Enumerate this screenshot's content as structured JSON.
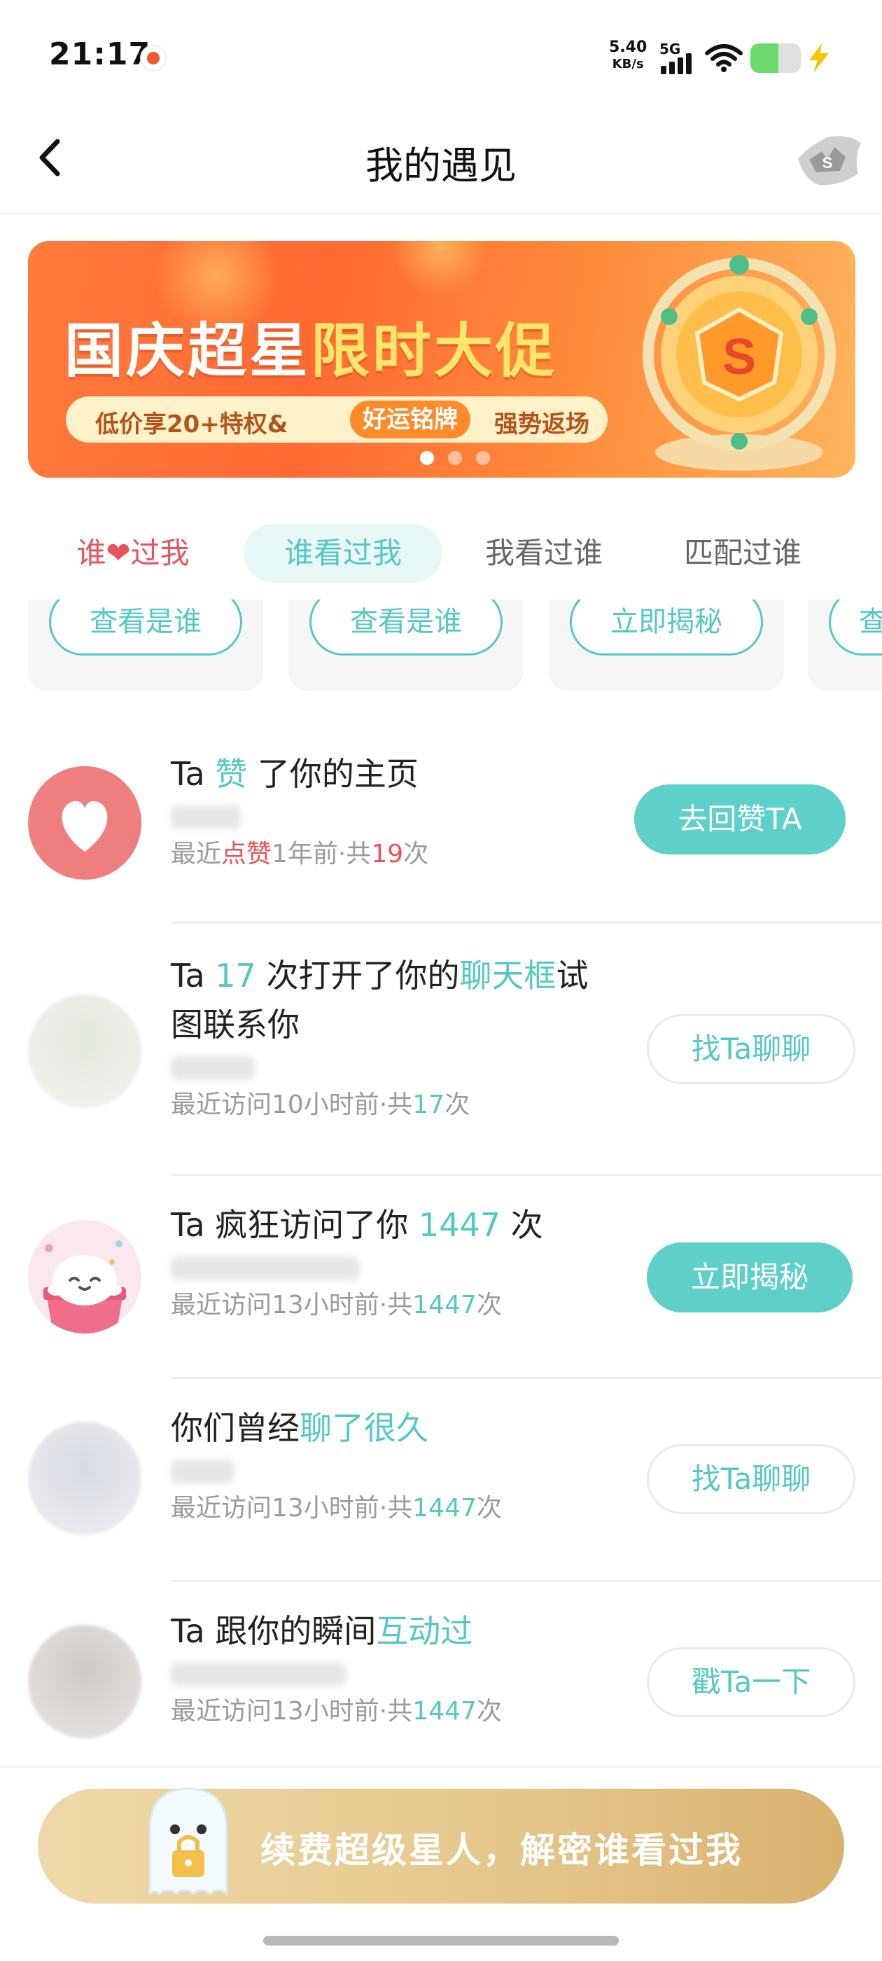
{
  "status_bar": {
    "time": "21:17",
    "net_speed": "5.40",
    "net_unit": "KB/s",
    "network_type": "5G",
    "battery_level": 0.55,
    "icons": [
      "app-notification-icon",
      "signal-icon",
      "wifi-icon",
      "battery-icon",
      "charging-icon"
    ]
  },
  "nav": {
    "title": "我的遇见",
    "back_icon": "chevron-left-icon",
    "right_icon": "super-star-badge-icon"
  },
  "banner": {
    "title_part1": "国庆超星",
    "title_part2": "限时大促",
    "sub_left": "低价享20+特权&",
    "sub_tag": "好运铭牌",
    "sub_right": "强势返场",
    "dots": 3,
    "active_dot": 0,
    "colors": {
      "bg": "#ff6a33",
      "highlight": "#ffe66b"
    }
  },
  "tabs": [
    {
      "label_pre": "谁",
      "heart": "❤",
      "label_post": "过我",
      "active": false
    },
    {
      "label": "谁看过我",
      "active": true
    },
    {
      "label": "我看过谁",
      "active": false
    },
    {
      "label": "匹配过谁",
      "active": false
    }
  ],
  "cards": [
    {
      "button": "查看是谁"
    },
    {
      "button": "查看是谁"
    },
    {
      "button": "立即揭秘"
    },
    {
      "button": "查"
    }
  ],
  "items": [
    {
      "title_a": "Ta ",
      "title_accent": "赞",
      "title_b": " 了你的主页",
      "meta_a": "最近",
      "meta_red": "点赞",
      "meta_b": "1年前·共",
      "meta_count": "19",
      "meta_c": "次",
      "button": "去回赞TA",
      "button_style": "solid",
      "avatar_icon": "heart-icon"
    },
    {
      "title_a": "Ta ",
      "title_accent": "17",
      "title_b": " 次打开了你的",
      "title_accent2": "聊天框",
      "title_c": "试",
      "title_line2": "图联系你",
      "meta_a": "最近访问10小时前·共",
      "meta_count": "17",
      "meta_c": "次",
      "button": "找Ta聊聊",
      "button_style": "outline"
    },
    {
      "title_a": "Ta 疯狂访问了你 ",
      "title_accent": "1447",
      "title_b": " 次",
      "meta_a": "最近访问13小时前·共",
      "meta_count": "1447",
      "meta_c": "次",
      "button": "立即揭秘",
      "button_style": "solid",
      "avatar_icon": "ghost-gift-icon"
    },
    {
      "title_a": "你们曾经",
      "title_accent": "聊了很久",
      "meta_a": "最近访问13小时前·共",
      "meta_count": "1447",
      "meta_c": "次",
      "button": "找Ta聊聊",
      "button_style": "outline"
    },
    {
      "title_a": "Ta 跟你的瞬间",
      "title_accent": "互动过",
      "meta_a": "最近访问13小时前·共",
      "meta_count": "1447",
      "meta_c": "次",
      "button": "戳Ta一下",
      "button_style": "outline"
    }
  ],
  "promo": {
    "text": "续费超级星人，解密谁看过我",
    "icon": "ghost-lock-icon"
  },
  "colors": {
    "accent": "#55c8c2",
    "button_solid": "#5fcfc9",
    "red": "#e9535a",
    "meta_gray": "#9b9b9b",
    "promo_gold": "#e6c88d"
  }
}
